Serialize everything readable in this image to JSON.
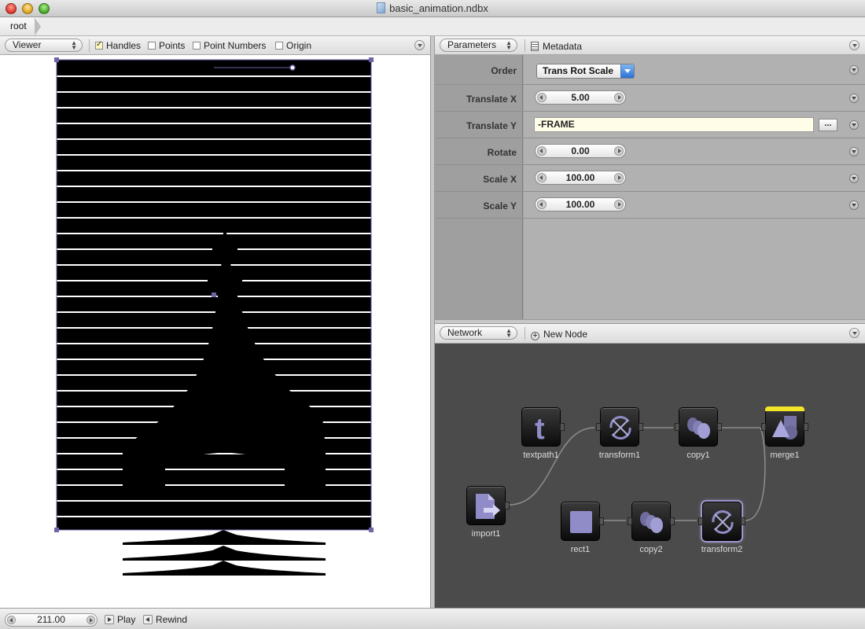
{
  "window": {
    "title": "basic_animation.ndbx"
  },
  "breadcrumb": {
    "root": "root"
  },
  "viewer": {
    "mode": "Viewer",
    "options": [
      {
        "label": "Handles",
        "checked": true
      },
      {
        "label": "Points",
        "checked": false
      },
      {
        "label": "Point Numbers",
        "checked": false
      },
      {
        "label": "Origin",
        "checked": false
      }
    ]
  },
  "parameters": {
    "tab": "Parameters",
    "metadata": "Metadata",
    "order": {
      "label": "Order",
      "value": "Trans Rot Scale"
    },
    "translate_x": {
      "label": "Translate X",
      "value": "5.00"
    },
    "translate_y": {
      "label": "Translate Y",
      "value": "-FRAME",
      "button": "..."
    },
    "rotate": {
      "label": "Rotate",
      "value": "0.00"
    },
    "scale_x": {
      "label": "Scale X",
      "value": "100.00"
    },
    "scale_y": {
      "label": "Scale Y",
      "value": "100.00"
    }
  },
  "network": {
    "tab": "Network",
    "new_node": "New Node",
    "nodes": [
      {
        "id": "textpath1",
        "label": "textpath1",
        "icon": "text-icon"
      },
      {
        "id": "transform1",
        "label": "transform1",
        "icon": "transform-icon"
      },
      {
        "id": "copy1",
        "label": "copy1",
        "icon": "copy-icon"
      },
      {
        "id": "merge1",
        "label": "merge1",
        "icon": "merge-icon",
        "rendered": true
      },
      {
        "id": "import1",
        "label": "import1",
        "icon": "import-icon"
      },
      {
        "id": "rect1",
        "label": "rect1",
        "icon": "rect-icon"
      },
      {
        "id": "copy2",
        "label": "copy2",
        "icon": "copy-icon"
      },
      {
        "id": "transform2",
        "label": "transform2",
        "icon": "transform-icon",
        "selected": true
      }
    ]
  },
  "bottom": {
    "frame": "211.00",
    "play": "Play",
    "rewind": "Rewind"
  },
  "colors": {
    "network_bg": "#4b4b4b",
    "handle": "#6e64a8",
    "rendered_flag": "#f3e528"
  }
}
